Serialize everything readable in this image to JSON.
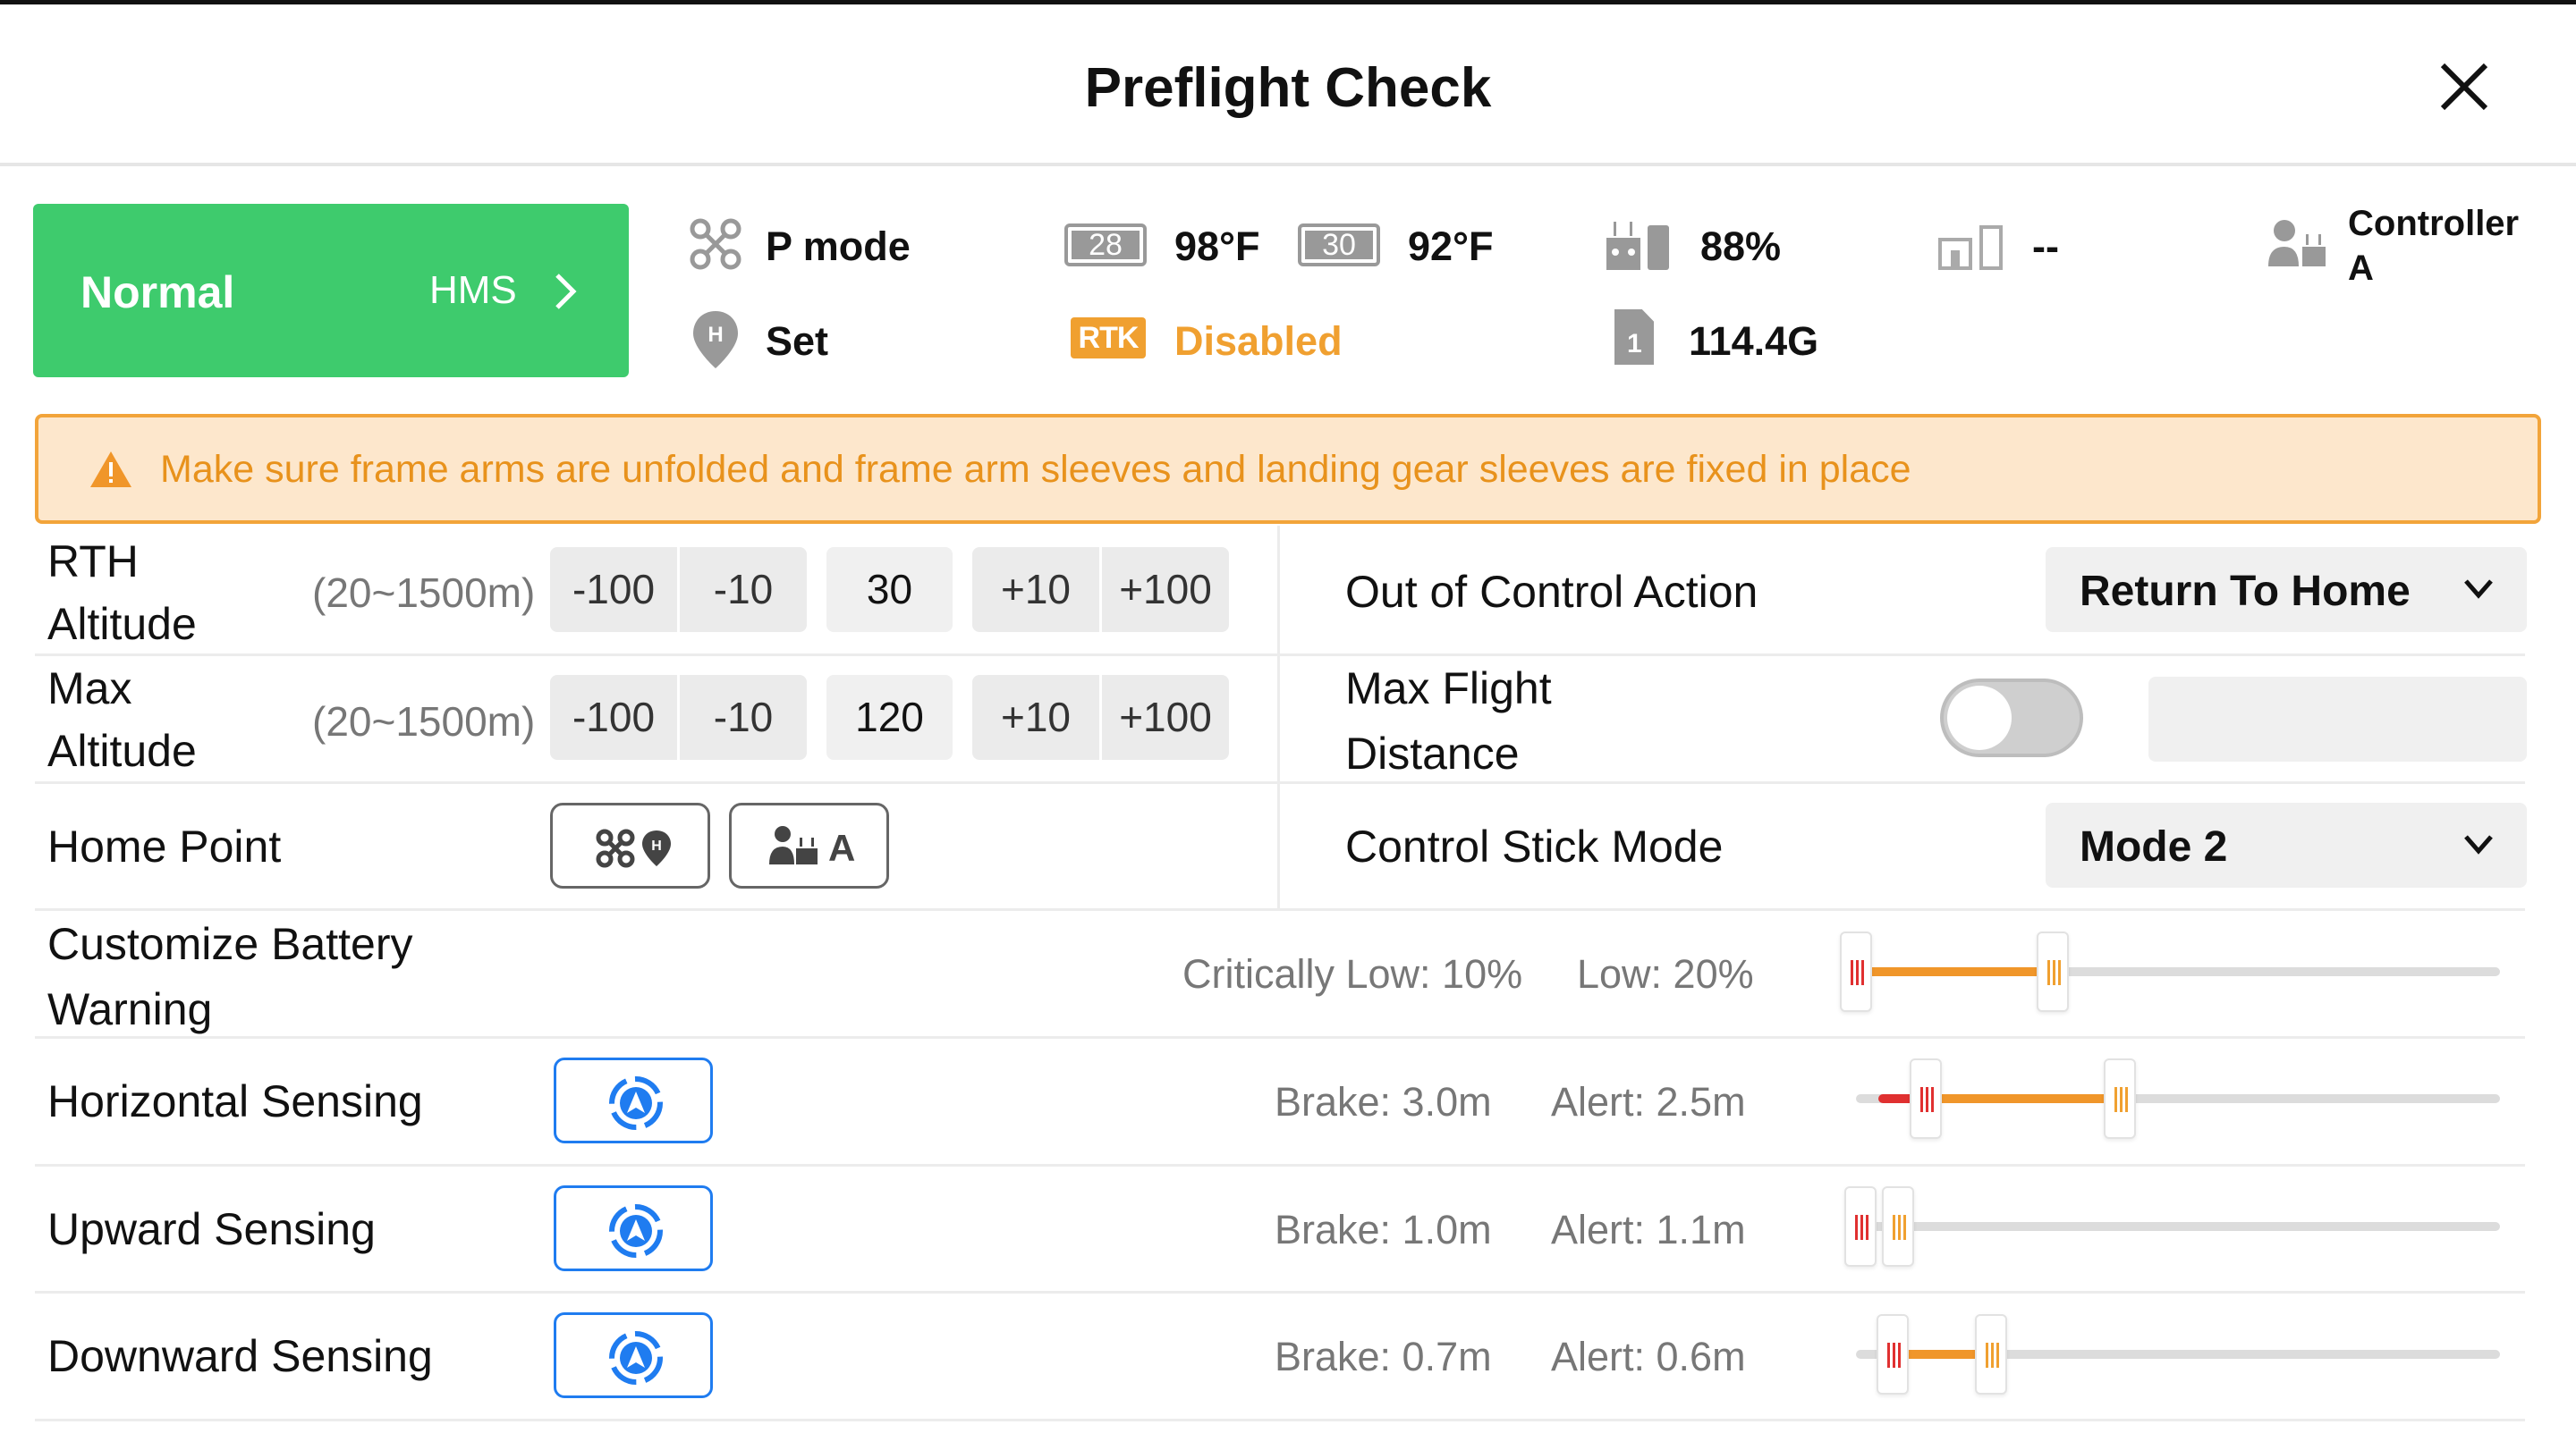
{
  "header": {
    "title": "Preflight Check",
    "close_icon": "close-icon"
  },
  "status_card": {
    "state": "Normal",
    "hms_label": "HMS",
    "color": "#3ecb6d"
  },
  "status": {
    "flight_mode": "P mode",
    "battery1": {
      "number": "28",
      "temp": "98°F"
    },
    "battery2": {
      "number": "30",
      "temp": "92°F"
    },
    "rc_battery": "88%",
    "second_rc_battery": "--",
    "controller_line1": "Controller",
    "controller_line2": "A",
    "home_point": "Set",
    "rtk_badge": "RTK",
    "rtk_status": "Disabled",
    "sd_card": "114.4G",
    "sd_card_number": "1"
  },
  "warning": {
    "text": "Make sure frame arms are unfolded and frame arm sleeves and landing gear sleeves are fixed in place",
    "color": "#e8921c"
  },
  "rth_altitude": {
    "label_line1": "RTH",
    "label_line2": "Altitude",
    "range": "(20~1500m)",
    "buttons": [
      "-100",
      "-10",
      "+10",
      "+100"
    ],
    "value": "30"
  },
  "max_altitude": {
    "label_line1": "Max",
    "label_line2": "Altitude",
    "range": "(20~1500m)",
    "buttons": [
      "-100",
      "-10",
      "+10",
      "+100"
    ],
    "value": "120"
  },
  "out_of_control": {
    "label": "Out of Control Action",
    "selected": "Return To Home"
  },
  "max_flight_distance": {
    "label_line1": "Max Flight",
    "label_line2": "Distance",
    "enabled": false,
    "value": ""
  },
  "home_point": {
    "label": "Home Point",
    "aircraft_button": "aircraft-home-icon",
    "controller_button_letter": "A"
  },
  "control_stick": {
    "label": "Control Stick Mode",
    "selected": "Mode 2"
  },
  "battery_warning": {
    "label_line1": "Customize Battery",
    "label_line2": "Warning",
    "critical": "Critically Low: 10%",
    "low": "Low: 20%"
  },
  "sensing": [
    {
      "label": "Horizontal Sensing",
      "brake": "Brake: 3.0m",
      "alert": "Alert: 2.5m"
    },
    {
      "label": "Upward Sensing",
      "brake": "Brake: 1.0m",
      "alert": "Alert: 1.1m"
    },
    {
      "label": "Downward Sensing",
      "brake": "Brake: 0.7m",
      "alert": "Alert: 0.6m"
    }
  ],
  "colors": {
    "accent_blue": "#1f7cf0",
    "orange": "#f0962a",
    "red": "#e03030"
  }
}
